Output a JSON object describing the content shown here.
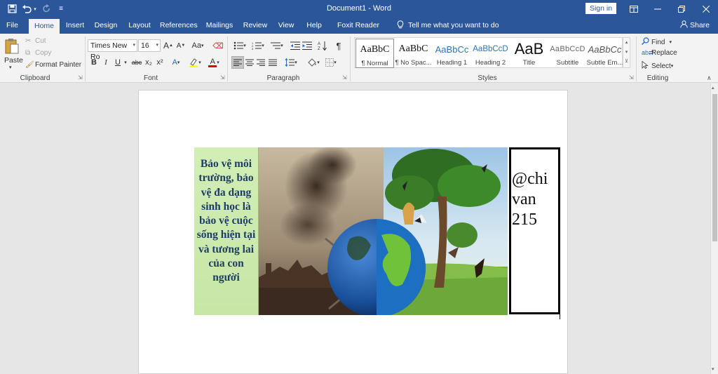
{
  "window": {
    "title": "Document1  -  Word",
    "sign_in": "Sign in"
  },
  "tabs": [
    "File",
    "Home",
    "Insert",
    "Design",
    "Layout",
    "References",
    "Mailings",
    "Review",
    "View",
    "Help",
    "Foxit Reader PDF"
  ],
  "active_tab": "Home",
  "tell_me": "Tell me what you want to do",
  "share": "Share",
  "clipboard": {
    "paste": "Paste",
    "cut": "Cut",
    "copy": "Copy",
    "format_painter": "Format Painter",
    "label": "Clipboard"
  },
  "font": {
    "name": "Times New Ro",
    "size": "16",
    "label": "Font",
    "bold": "B",
    "italic": "I",
    "underline": "U",
    "strike": "abc",
    "subscript": "x₂",
    "superscript": "x²",
    "grow": "A",
    "shrink": "A",
    "case": "Aa",
    "color_a": "A",
    "highlight_color": "#ffff00",
    "font_color": "#e00000"
  },
  "paragraph": {
    "label": "Paragraph",
    "pilcrow": "¶"
  },
  "styles": {
    "label": "Styles",
    "items": [
      {
        "sample": "AaBbC",
        "name": "¶ Normal"
      },
      {
        "sample": "AaBbC",
        "name": "¶ No Spac..."
      },
      {
        "sample": "AaBbCc",
        "name": "Heading 1"
      },
      {
        "sample": "AaBbCcD",
        "name": "Heading 2"
      },
      {
        "sample": "AaB",
        "name": "Title"
      },
      {
        "sample": "AaBbCcD",
        "name": "Subtitle"
      },
      {
        "sample": "AaBbCc",
        "name": "Subtle Em..."
      }
    ]
  },
  "editing": {
    "label": "Editing",
    "find": "Find",
    "replace": "Replace",
    "select": "Select"
  },
  "document": {
    "left_text": "Bảo vệ môi trường, bảo vệ đa dạng sinh học là bảo vệ cuộc sống hiện tại và tương lai của con người",
    "right_text": "@chi van 215"
  },
  "colors": {
    "word_blue": "#2b579a",
    "left_panel_text": "#1d3c63",
    "left_panel_bg": "#d2eeb5"
  }
}
